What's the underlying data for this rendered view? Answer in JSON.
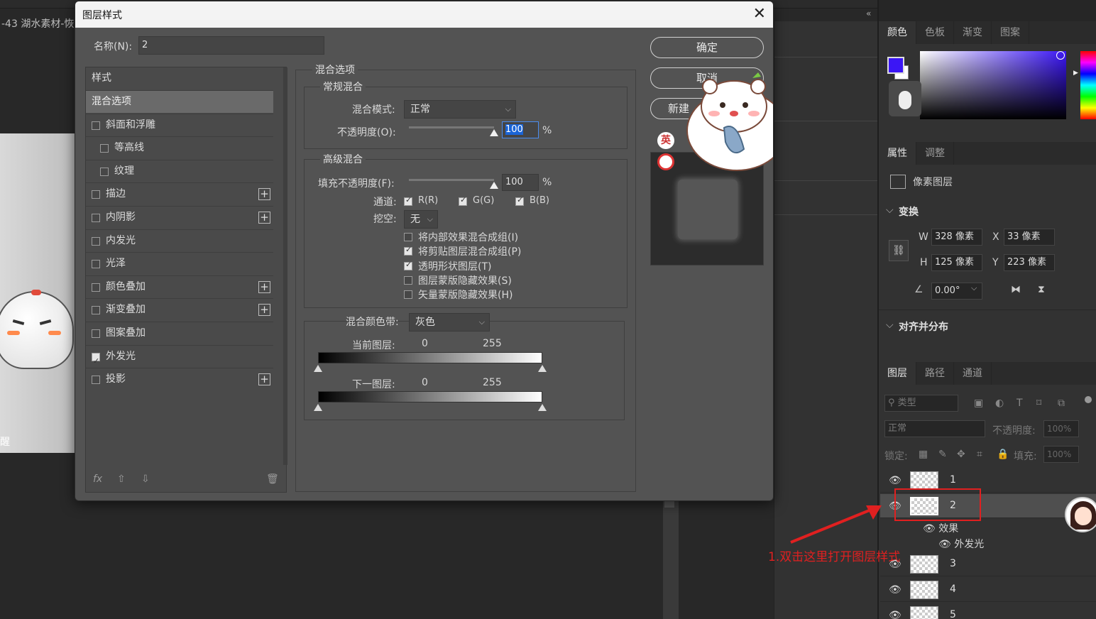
{
  "workspace": {
    "doc_tab": "-43 湖水素材-恢",
    "canvas_cut_char": "醒"
  },
  "dialog": {
    "title": "图层样式",
    "close_glyph": "✕",
    "name_label": "名称(N):",
    "name_value": "2",
    "styles_header": "样式",
    "style_items": [
      {
        "label": "混合选项",
        "checkbox": false,
        "checked": false,
        "plus": false,
        "indent": 0,
        "active": true
      },
      {
        "label": "斜面和浮雕",
        "checkbox": true,
        "checked": false,
        "plus": false,
        "indent": 0
      },
      {
        "label": "等高线",
        "checkbox": true,
        "checked": false,
        "plus": false,
        "indent": 1
      },
      {
        "label": "纹理",
        "checkbox": true,
        "checked": false,
        "plus": false,
        "indent": 1
      },
      {
        "label": "描边",
        "checkbox": true,
        "checked": false,
        "plus": true,
        "indent": 0
      },
      {
        "label": "内阴影",
        "checkbox": true,
        "checked": false,
        "plus": true,
        "indent": 0
      },
      {
        "label": "内发光",
        "checkbox": true,
        "checked": false,
        "plus": false,
        "indent": 0
      },
      {
        "label": "光泽",
        "checkbox": true,
        "checked": false,
        "plus": false,
        "indent": 0
      },
      {
        "label": "颜色叠加",
        "checkbox": true,
        "checked": false,
        "plus": true,
        "indent": 0
      },
      {
        "label": "渐变叠加",
        "checkbox": true,
        "checked": false,
        "plus": true,
        "indent": 0
      },
      {
        "label": "图案叠加",
        "checkbox": true,
        "checked": false,
        "plus": false,
        "indent": 0
      },
      {
        "label": "外发光",
        "checkbox": true,
        "checked": true,
        "plus": false,
        "indent": 0
      },
      {
        "label": "投影",
        "checkbox": true,
        "checked": false,
        "plus": true,
        "indent": 0
      }
    ],
    "footer": {
      "fx": "fx",
      "up": "⇧",
      "down": "⇩",
      "trash": "🗑"
    },
    "blend_options": {
      "title": "混合选项",
      "general": {
        "title": "常规混合",
        "mode_label": "混合模式:",
        "mode_value": "正常",
        "opacity_label": "不透明度(O):",
        "opacity_value": "100",
        "percent": "%",
        "opacity_level": 100
      },
      "advanced": {
        "title": "高级混合",
        "fill_label": "填充不透明度(F):",
        "fill_value": "100",
        "percent": "%",
        "fill_level": 100,
        "channels_label": "通道:",
        "channels": [
          {
            "label": "R(R)",
            "checked": true
          },
          {
            "label": "G(G)",
            "checked": true
          },
          {
            "label": "B(B)",
            "checked": true
          }
        ],
        "knockout_label": "挖空:",
        "knockout_value": "无",
        "options": [
          {
            "label": "将内部效果混合成组(I)",
            "checked": false
          },
          {
            "label": "将剪贴图层混合成组(P)",
            "checked": true
          },
          {
            "label": "透明形状图层(T)",
            "checked": true
          },
          {
            "label": "图层蒙版隐藏效果(S)",
            "checked": false
          },
          {
            "label": "矢量蒙版隐藏效果(H)",
            "checked": false
          }
        ]
      },
      "blend_if": {
        "label": "混合颜色带:",
        "value": "灰色",
        "this_layer_label": "当前图层:",
        "this_min": "0",
        "this_max": "255",
        "underlying_label": "下一图层:",
        "under_min": "0",
        "under_max": "255"
      }
    },
    "buttons": {
      "ok": "确定",
      "cancel": "取消",
      "new_style": "新建"
    },
    "ime": "英"
  },
  "right_panel": {
    "color_tabs": [
      "颜色",
      "色板",
      "渐变",
      "图案"
    ],
    "foreground_color": "#3b16f5",
    "background_color": "#ffffff",
    "props_tabs": [
      "属性",
      "调整"
    ],
    "pixel_layer_label": "像素图层",
    "transform": {
      "title": "变换",
      "w_label": "W",
      "w_value": "328 像素",
      "x_label": "X",
      "x_value": "33 像素",
      "h_label": "H",
      "h_value": "125 像素",
      "y_label": "Y",
      "y_value": "223 像素",
      "angle_value": "0.00°"
    },
    "align": {
      "title": "对齐并分布"
    },
    "layers_tabs": [
      "图层",
      "路径",
      "通道"
    ],
    "filter_kind": "类型",
    "blend_mode": "正常",
    "opacity_label": "不透明度:",
    "opacity_value": "100%",
    "lock_label": "锁定:",
    "fill_label": "填充:",
    "fill_value": "100%",
    "layers": [
      {
        "name": "1",
        "selected": false
      },
      {
        "name": "2",
        "selected": true
      },
      {
        "name": "3",
        "selected": false
      },
      {
        "name": "4",
        "selected": false
      },
      {
        "name": "5",
        "selected": false
      }
    ],
    "effects_label": "效果",
    "outer_glow_label": "外发光"
  },
  "annotation": {
    "text": "1.双击这里打开图层样式",
    "color": "#e02020"
  }
}
